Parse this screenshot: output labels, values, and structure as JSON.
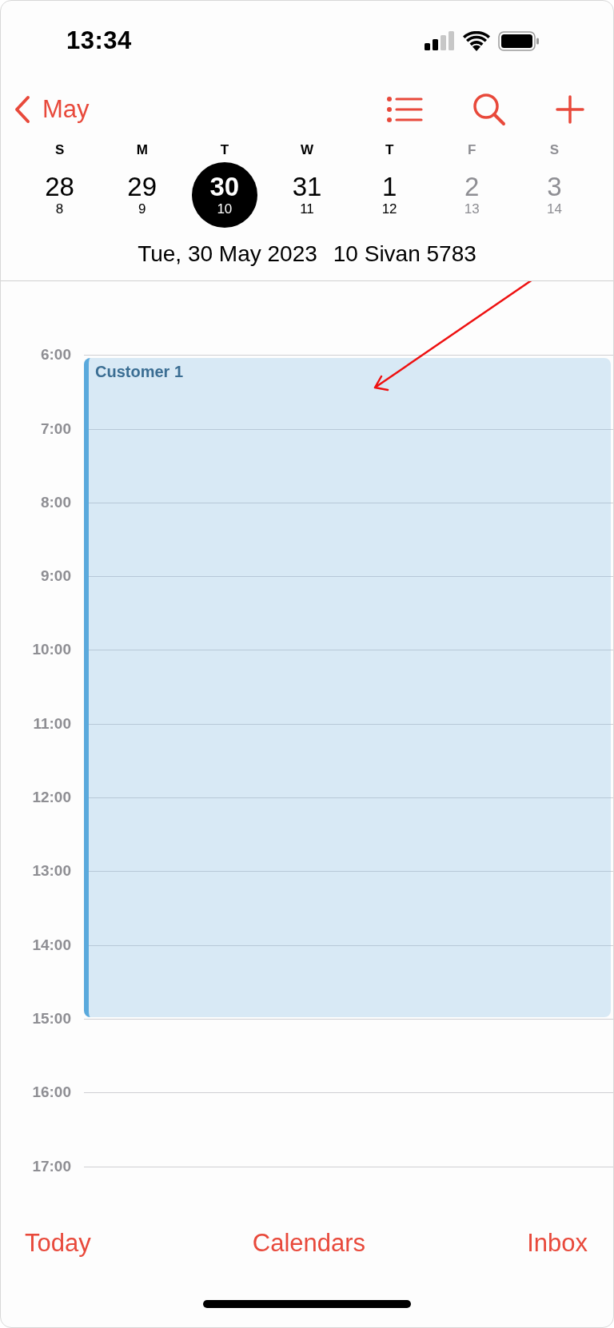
{
  "status_bar": {
    "time": "13:34"
  },
  "nav": {
    "back_label": "May"
  },
  "week": [
    {
      "weekday": "S",
      "day": "28",
      "sub": "8",
      "selected": false,
      "dimmed": false
    },
    {
      "weekday": "M",
      "day": "29",
      "sub": "9",
      "selected": false,
      "dimmed": false
    },
    {
      "weekday": "T",
      "day": "30",
      "sub": "10",
      "selected": true,
      "dimmed": false
    },
    {
      "weekday": "W",
      "day": "31",
      "sub": "11",
      "selected": false,
      "dimmed": false
    },
    {
      "weekday": "T",
      "day": "1",
      "sub": "12",
      "selected": false,
      "dimmed": false
    },
    {
      "weekday": "F",
      "day": "2",
      "sub": "13",
      "selected": false,
      "dimmed": true
    },
    {
      "weekday": "S",
      "day": "3",
      "sub": "14",
      "selected": false,
      "dimmed": true
    }
  ],
  "date_line": {
    "gregorian": "Tue, 30 May 2023",
    "hebrew": "10 Sivan 5783"
  },
  "event": {
    "title": "Customer 1"
  },
  "hours": [
    {
      "label": "6:00",
      "in_event": true
    },
    {
      "label": "7:00",
      "in_event": true
    },
    {
      "label": "8:00",
      "in_event": true
    },
    {
      "label": "9:00",
      "in_event": true
    },
    {
      "label": "10:00",
      "in_event": true
    },
    {
      "label": "11:00",
      "in_event": true
    },
    {
      "label": "12:00",
      "in_event": true
    },
    {
      "label": "13:00",
      "in_event": true
    },
    {
      "label": "14:00",
      "in_event": true
    },
    {
      "label": "15:00",
      "in_event": false
    },
    {
      "label": "16:00",
      "in_event": false
    },
    {
      "label": "17:00",
      "in_event": false
    }
  ],
  "toolbar": [
    "Today",
    "Calendars",
    "Inbox"
  ]
}
